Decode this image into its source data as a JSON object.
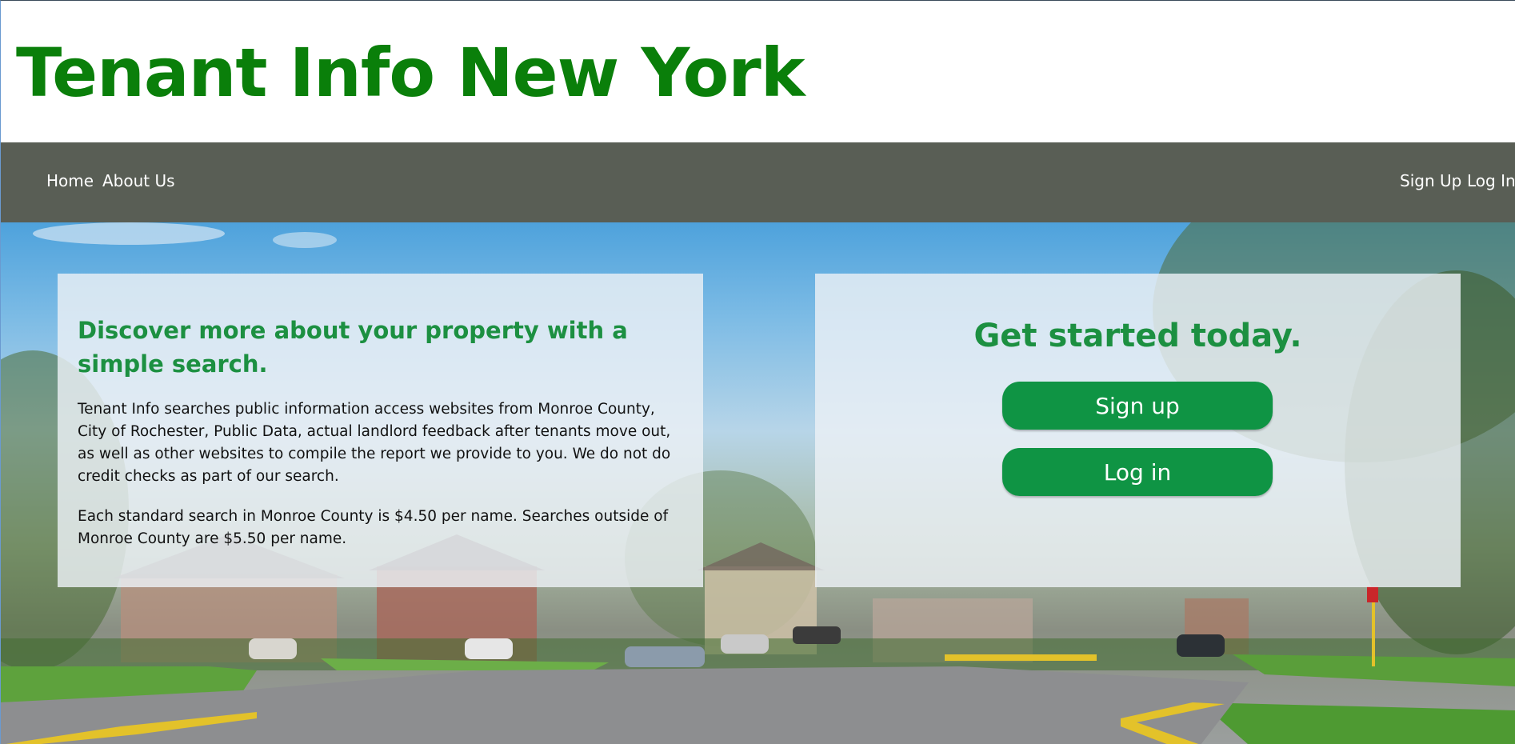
{
  "header": {
    "site_title": "Tenant Info New York"
  },
  "nav": {
    "left_links": [
      "Home",
      "About Us"
    ],
    "right_links": [
      "Sign Up",
      "Log In"
    ]
  },
  "info_panel": {
    "heading": "Discover more about your property with a simple search.",
    "paragraph_1": "Tenant Info searches public information access websites from Monroe County, City of Rochester, Public Data, actual landlord feedback after tenants move out, as well as other websites to compile the report we provide to you. We do not do credit checks as part of our search.",
    "paragraph_2": "Each standard search in Monroe County is $4.50 per name. Searches outside of Monroe County are $5.50 per name."
  },
  "cta_panel": {
    "heading": "Get started today.",
    "signup_label": "Sign up",
    "login_label": "Log in"
  },
  "colors": {
    "title_green": "#0a7f0a",
    "accent_green": "#1c9041",
    "button_green": "#0f9444",
    "nav_bg": "#595e55"
  }
}
